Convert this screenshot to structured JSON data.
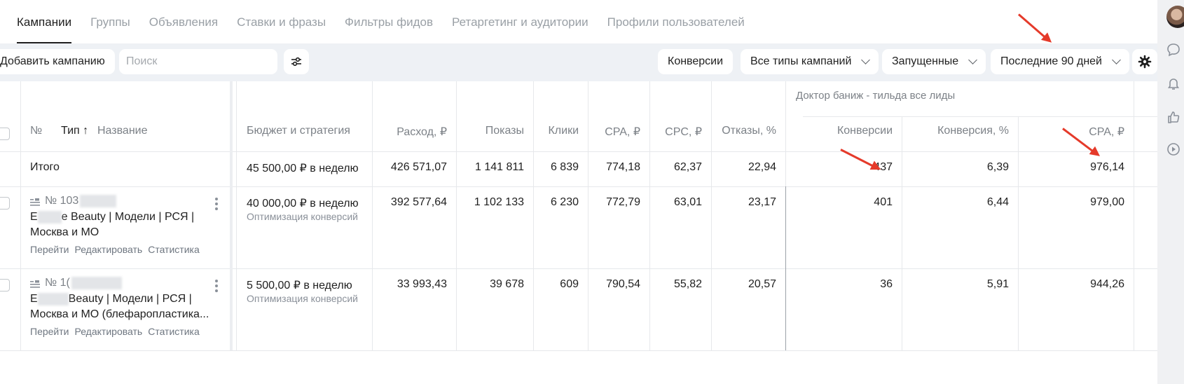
{
  "tabs": [
    "Кампании",
    "Группы",
    "Объявления",
    "Ставки и фразы",
    "Фильтры фидов",
    "Ретаргетинг и аудитории",
    "Профили пользователей"
  ],
  "toolbar": {
    "add_label": "Добавить кампанию",
    "search_placeholder": "Поиск",
    "conversions_label": "Конверсии",
    "campaign_types_label": "Все типы кампаний",
    "status_label": "Запущенные",
    "period_label": "Последние 90 дней"
  },
  "table": {
    "goal_group": "Доктор баниж - тильда все лиды",
    "headers": {
      "num": "№",
      "type": "Тип ↑",
      "name": "Название",
      "budget": "Бюджет и стратегия",
      "spend": "Расход, ₽",
      "impressions": "Показы",
      "clicks": "Клики",
      "cpa": "CPA, ₽",
      "cpc": "CPC, ₽",
      "bounce": "Отказы, %",
      "conversions": "Конверсии",
      "conv_rate": "Конверсия, %",
      "goal_cpa": "CPA, ₽"
    },
    "total": {
      "label": "Итого",
      "budget": "45 500,00 ₽ в неделю",
      "spend": "426 571,07",
      "impressions": "1 141 811",
      "clicks": "6 839",
      "cpa": "774,18",
      "cpc": "62,37",
      "bounce": "22,94",
      "conversions": "437",
      "conv_rate": "6,39",
      "goal_cpa": "976,14"
    },
    "rows": [
      {
        "number": "№ 103",
        "name_prefix": "E",
        "name_line1": "e Beauty | Модели | РСЯ |",
        "name_line2": "Москва и МО",
        "budget": "40 000,00 ₽ в неделю",
        "strategy": "Оптимизация конверсий",
        "spend": "392 577,64",
        "impressions": "1 102 133",
        "clicks": "6 230",
        "cpa": "772,79",
        "cpc": "63,01",
        "bounce": "23,17",
        "conversions": "401",
        "conv_rate": "6,44",
        "goal_cpa": "979,00"
      },
      {
        "number": "№ 1(",
        "name_prefix": "E",
        "name_line1": "Beauty | Модели | РСЯ |",
        "name_line2": "Москва и МО (блефаропластика...",
        "budget": "5 500,00 ₽ в неделю",
        "strategy": "Оптимизация конверсий",
        "spend": "33 993,43",
        "impressions": "39 678",
        "clicks": "609",
        "cpa": "790,54",
        "cpc": "55,82",
        "bounce": "20,57",
        "conversions": "36",
        "conv_rate": "5,91",
        "goal_cpa": "944,26"
      }
    ],
    "row_links": [
      "Перейти",
      "Редактировать",
      "Статистика"
    ]
  },
  "colors": {
    "annotation_arrow": "#e53a2a",
    "toolbar_bg": "#eef1f5",
    "muted_text": "#7c8187"
  },
  "icons": [
    "settings-sliders-icon",
    "gear-icon",
    "chat-icon",
    "bell-icon",
    "thumbs-up-icon",
    "play-icon",
    "campaign-type-icon",
    "more-vert-icon",
    "chevron-down-icon"
  ]
}
